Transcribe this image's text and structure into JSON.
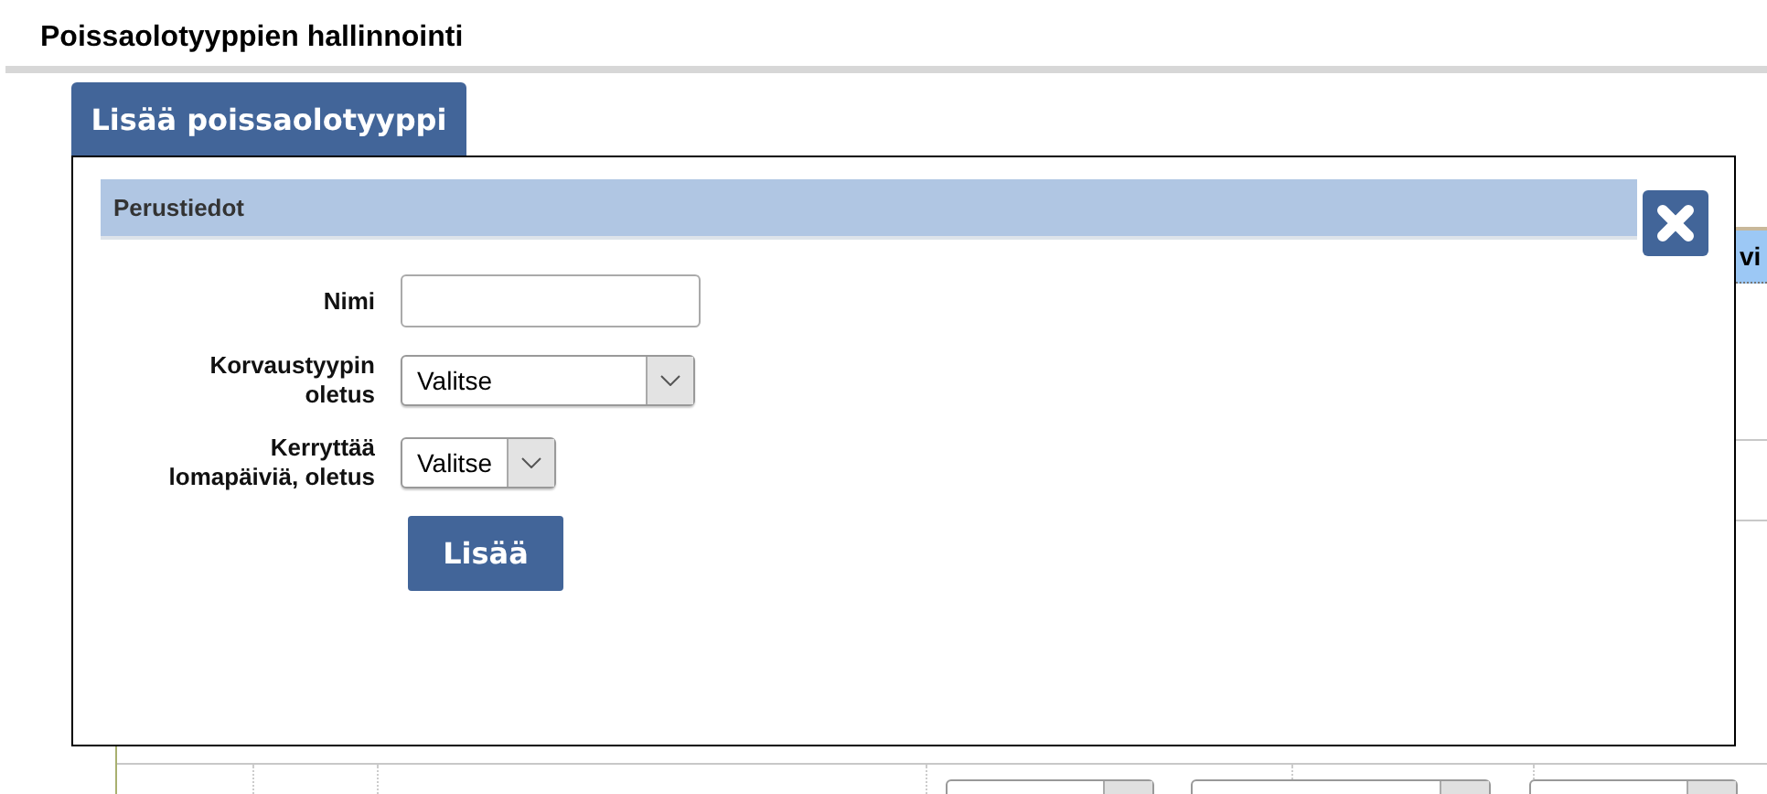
{
  "page": {
    "title": "Poissaolotyyppien hallinnointi"
  },
  "add_tab": {
    "label": "Lisää poissaolotyyppi"
  },
  "background_table": {
    "visible_header": "vi"
  },
  "dialog": {
    "section": "Perustiedot",
    "fields": [
      {
        "kind": "text",
        "label": [
          "Nimi"
        ]
      },
      {
        "kind": "select",
        "label": [
          "Korvaustyypin",
          "oletus"
        ],
        "value": "Valitse"
      },
      {
        "kind": "select",
        "label": [
          "Kerryttää",
          "lomapäiviä, oletus"
        ],
        "value": "Valitse"
      }
    ],
    "submit": "Lisää"
  }
}
